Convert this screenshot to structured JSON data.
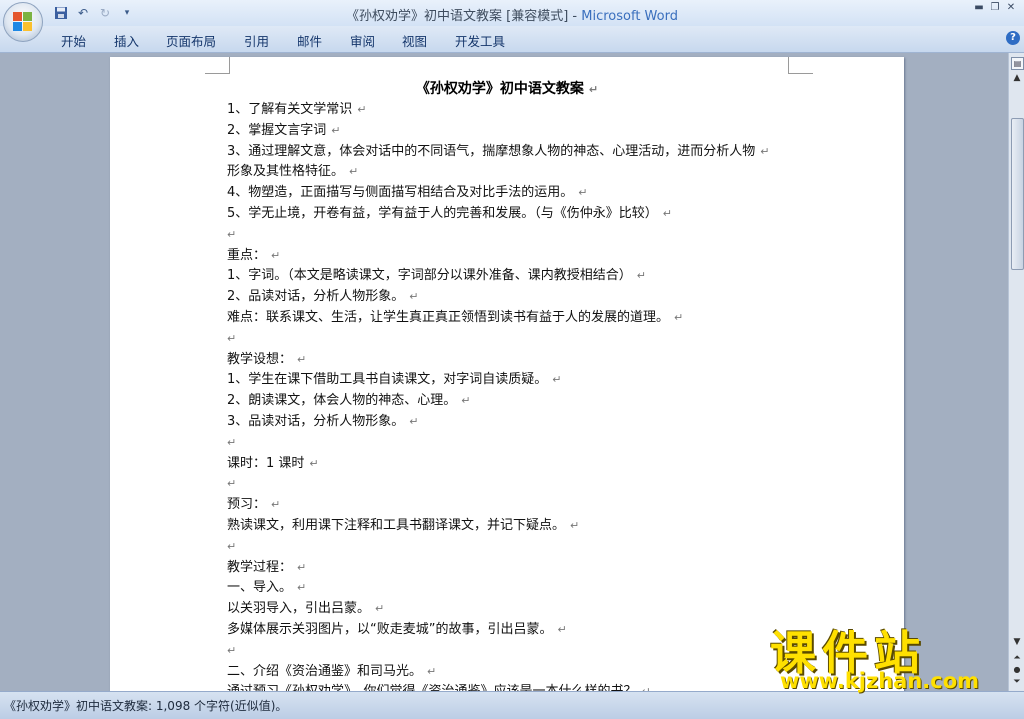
{
  "window": {
    "doc_title": "《孙权劝学》初中语文教案 [兼容模式] - ",
    "app_name": "Microsoft Word",
    "controls": [
      "▬",
      "❐",
      "✕"
    ]
  },
  "ribbon_tabs": [
    "开始",
    "插入",
    "页面布局",
    "引用",
    "邮件",
    "审阅",
    "视图",
    "开发工具"
  ],
  "document": {
    "heading": "《孙权劝学》初中语文教案",
    "lines": [
      "1、了解有关文学常识",
      "2、掌握文言字词",
      "3、通过理解文意，体会对话中的不同语气，揣摩想象人物的神态、心理活动，进而分析人物",
      "形象及其性格特征。",
      "4、物塑造，正面描写与侧面描写相结合及对比手法的运用。",
      "5、学无止境，开卷有益，学有益于人的完善和发展。（与《伤仲永》比较）",
      "",
      "重点：",
      "1、字词。（本文是略读课文，字词部分以课外准备、课内教授相结合）",
      "2、品读对话，分析人物形象。",
      "难点：联系课文、生活，让学生真正真正领悟到读书有益于人的发展的道理。",
      "",
      "教学设想：",
      "1、学生在课下借助工具书自读课文，对字词自读质疑。",
      "2、朗读课文，体会人物的神态、心理。",
      "3、品读对话，分析人物形象。",
      "",
      "课时：1 课时",
      "",
      "预习：",
      "熟读课文，利用课下注释和工具书翻译课文，并记下疑点。",
      "",
      "教学过程：",
      "一、导入。",
      "以关羽导入，引出吕蒙。",
      "多媒体展示关羽图片，以“败走麦城”的故事，引出吕蒙。",
      "",
      "二、介绍《资治通鉴》和司马光。",
      "通过预习《孙权劝学》，你们觉得《资治通鉴》应该是一本什么样的书？"
    ],
    "paragraph_mark": "↵"
  },
  "statusbar": {
    "text": "《孙权劝学》初中语文教案: 1,098 个字符(近似值)。"
  },
  "watermark": {
    "chars": "课件站",
    "url": "www.kjzhan.com"
  },
  "colors": {
    "accent": "#3a6fbd",
    "workspace": "#a3afc1",
    "watermark": "#ffe000"
  }
}
